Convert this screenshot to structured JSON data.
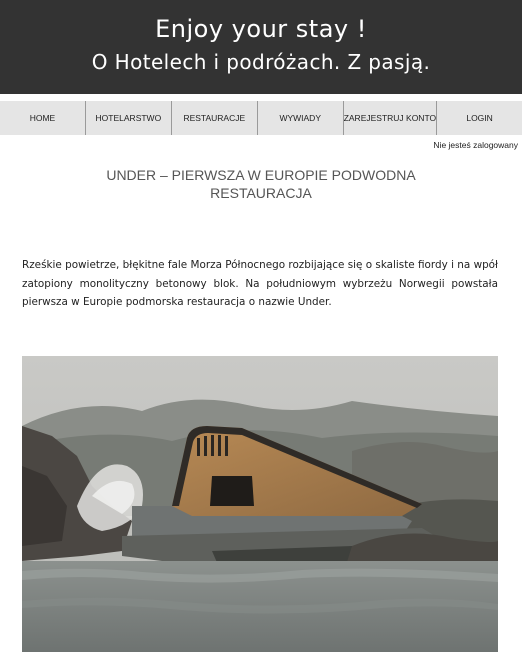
{
  "header": {
    "title": "Enjoy your stay !",
    "subtitle": "O Hotelech i podróżach. Z pasją."
  },
  "nav": {
    "items": [
      "HOME",
      "HOTELARSTWO",
      "RESTAURACJE",
      "WYWIADY",
      "ZAREJESTRUJ KONTO",
      "LOGIN"
    ]
  },
  "login_status": "Nie jesteś zalogowany",
  "post": {
    "title": "UNDER – PIERWSZA W EUROPIE PODWODNA RESTAURACJA",
    "body": "Rześkie powietrze, błękitne fale Morza Północnego rozbijające się o skaliste fiordy i na wpół zatopiony monolityczny betonowy blok. Na południowym wybrzeżu Norwegii powstała pierwsza w Europie podmorska restauracja o nazwie Under."
  }
}
